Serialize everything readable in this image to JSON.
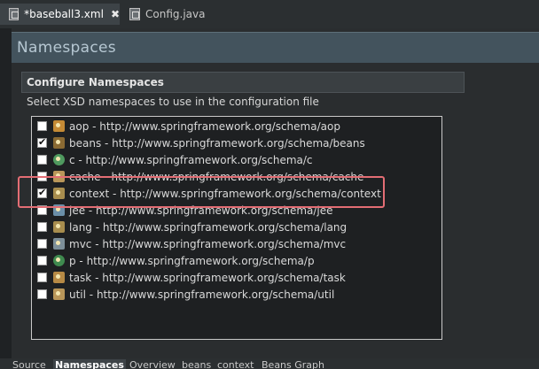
{
  "tabs": [
    {
      "label": "*baseball3.xml",
      "close": "✖"
    },
    {
      "label": "Config.java"
    }
  ],
  "editor": {
    "header": "Namespaces",
    "section_title": "Configure Namespaces",
    "description": "Select XSD namespaces to use in the configuration file"
  },
  "namespaces": [
    {
      "label": "aop - http://www.springframework.org/schema/aop",
      "checked": false,
      "icon": "aop-icon",
      "color": "#c48a35"
    },
    {
      "label": "beans - http://www.springframework.org/schema/beans",
      "checked": true,
      "icon": "beans-icon",
      "color": "#8a6a33"
    },
    {
      "label": "c - http://www.springframework.org/schema/c",
      "checked": false,
      "icon": "c-namespace-icon",
      "color": "#4f9a5f"
    },
    {
      "label": "cache - http://www.springframework.org/schema/cache",
      "checked": false,
      "icon": "cache-icon",
      "color": "#b99659"
    },
    {
      "label": "context - http://www.springframework.org/schema/context",
      "checked": true,
      "icon": "context-icon",
      "color": "#a88d4e"
    },
    {
      "label": "jee - http://www.springframework.org/schema/jee",
      "checked": false,
      "icon": "jee-icon",
      "color": "#6b8fa8"
    },
    {
      "label": "lang - http://www.springframework.org/schema/lang",
      "checked": false,
      "icon": "lang-icon",
      "color": "#a88d4e"
    },
    {
      "label": "mvc - http://www.springframework.org/schema/mvc",
      "checked": false,
      "icon": "mvc-icon",
      "color": "#7d8f99"
    },
    {
      "label": "p - http://www.springframework.org/schema/p",
      "checked": false,
      "icon": "p-namespace-icon",
      "color": "#3f8a4f"
    },
    {
      "label": "task - http://www.springframework.org/schema/task",
      "checked": false,
      "icon": "task-icon",
      "color": "#b78a45"
    },
    {
      "label": "util - http://www.springframework.org/schema/util",
      "checked": false,
      "icon": "util-icon",
      "color": "#b99659"
    }
  ],
  "bottom_tabs": [
    "Source",
    "Namespaces",
    "Overview",
    "beans",
    "context",
    "Beans Graph"
  ]
}
